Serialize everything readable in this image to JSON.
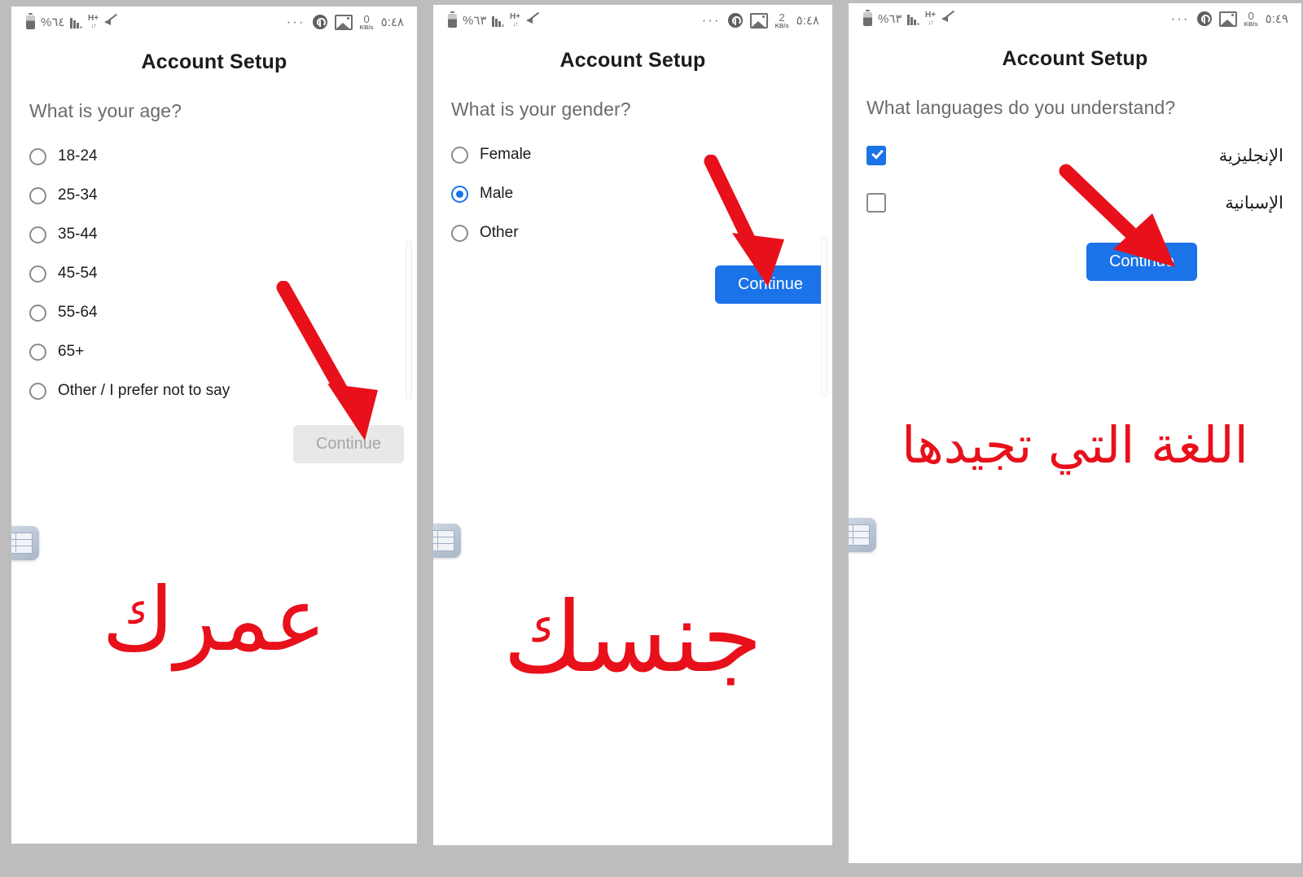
{
  "meta": {
    "background_color": "#bdbdbd",
    "panel_background": "#ffffff",
    "accent_color": "#1a73e8",
    "annotation_color": "#e8101b",
    "disabled_button_bg": "#e8e8e8",
    "disabled_button_text": "#a6a6a6"
  },
  "panels": [
    {
      "status_bar": {
        "battery_percent": "%٦٤",
        "network_type": "H+",
        "network_arrows": "↓↑",
        "overflow_dots": "···",
        "data_speed_value": "0",
        "data_speed_unit": "KB/s",
        "clock": "٥:٤٨",
        "icons": [
          "battery-icon",
          "signal-bars-icon",
          "network-hplus-icon",
          "volume-muted-icon",
          "more-dots-icon",
          "vpn-icon",
          "screenshot-icon",
          "data-speed-indicator",
          "clock"
        ]
      },
      "app_title": "Account Setup",
      "question": "What is your age?",
      "input_type": "radio",
      "options": [
        {
          "label": "18-24",
          "selected": false
        },
        {
          "label": "25-34",
          "selected": false
        },
        {
          "label": "35-44",
          "selected": false
        },
        {
          "label": "45-54",
          "selected": false
        },
        {
          "label": "55-64",
          "selected": false
        },
        {
          "label": "65+",
          "selected": false
        },
        {
          "label": "Other / I prefer not to say",
          "selected": false
        }
      ],
      "continue_button": {
        "label": "Continue",
        "state": "disabled"
      },
      "annotation_text": "عمرك"
    },
    {
      "status_bar": {
        "battery_percent": "%٦٣",
        "network_type": "H+",
        "network_arrows": "↓↑",
        "overflow_dots": "···",
        "data_speed_value": "2",
        "data_speed_unit": "KB/s",
        "clock": "٥:٤٨",
        "icons": [
          "battery-icon",
          "signal-bars-icon",
          "network-hplus-icon",
          "volume-muted-icon",
          "more-dots-icon",
          "vpn-icon",
          "screenshot-icon",
          "data-speed-indicator",
          "clock"
        ]
      },
      "app_title": "Account Setup",
      "question": "What is your gender?",
      "input_type": "radio",
      "options": [
        {
          "label": "Female",
          "selected": false
        },
        {
          "label": "Male",
          "selected": true
        },
        {
          "label": "Other",
          "selected": false
        }
      ],
      "continue_button": {
        "label": "Continue",
        "state": "enabled"
      },
      "annotation_text": "جنسك"
    },
    {
      "status_bar": {
        "battery_percent": "%٦٣",
        "network_type": "H+",
        "network_arrows": "↓↑",
        "overflow_dots": "···",
        "data_speed_value": "0",
        "data_speed_unit": "KB/s",
        "clock": "٥:٤٩",
        "icons": [
          "battery-icon",
          "signal-bars-icon",
          "network-hplus-icon",
          "volume-muted-icon",
          "more-dots-icon",
          "vpn-icon",
          "screenshot-icon",
          "data-speed-indicator",
          "clock"
        ]
      },
      "app_title": "Account Setup",
      "question": "What languages do you understand?",
      "input_type": "checkbox",
      "options": [
        {
          "label": "الإنجليزية",
          "checked": true
        },
        {
          "label": "الإسبانية",
          "checked": false
        }
      ],
      "continue_button": {
        "label": "Continue",
        "state": "enabled"
      },
      "annotation_text": "اللغة التي تجيدها"
    }
  ]
}
